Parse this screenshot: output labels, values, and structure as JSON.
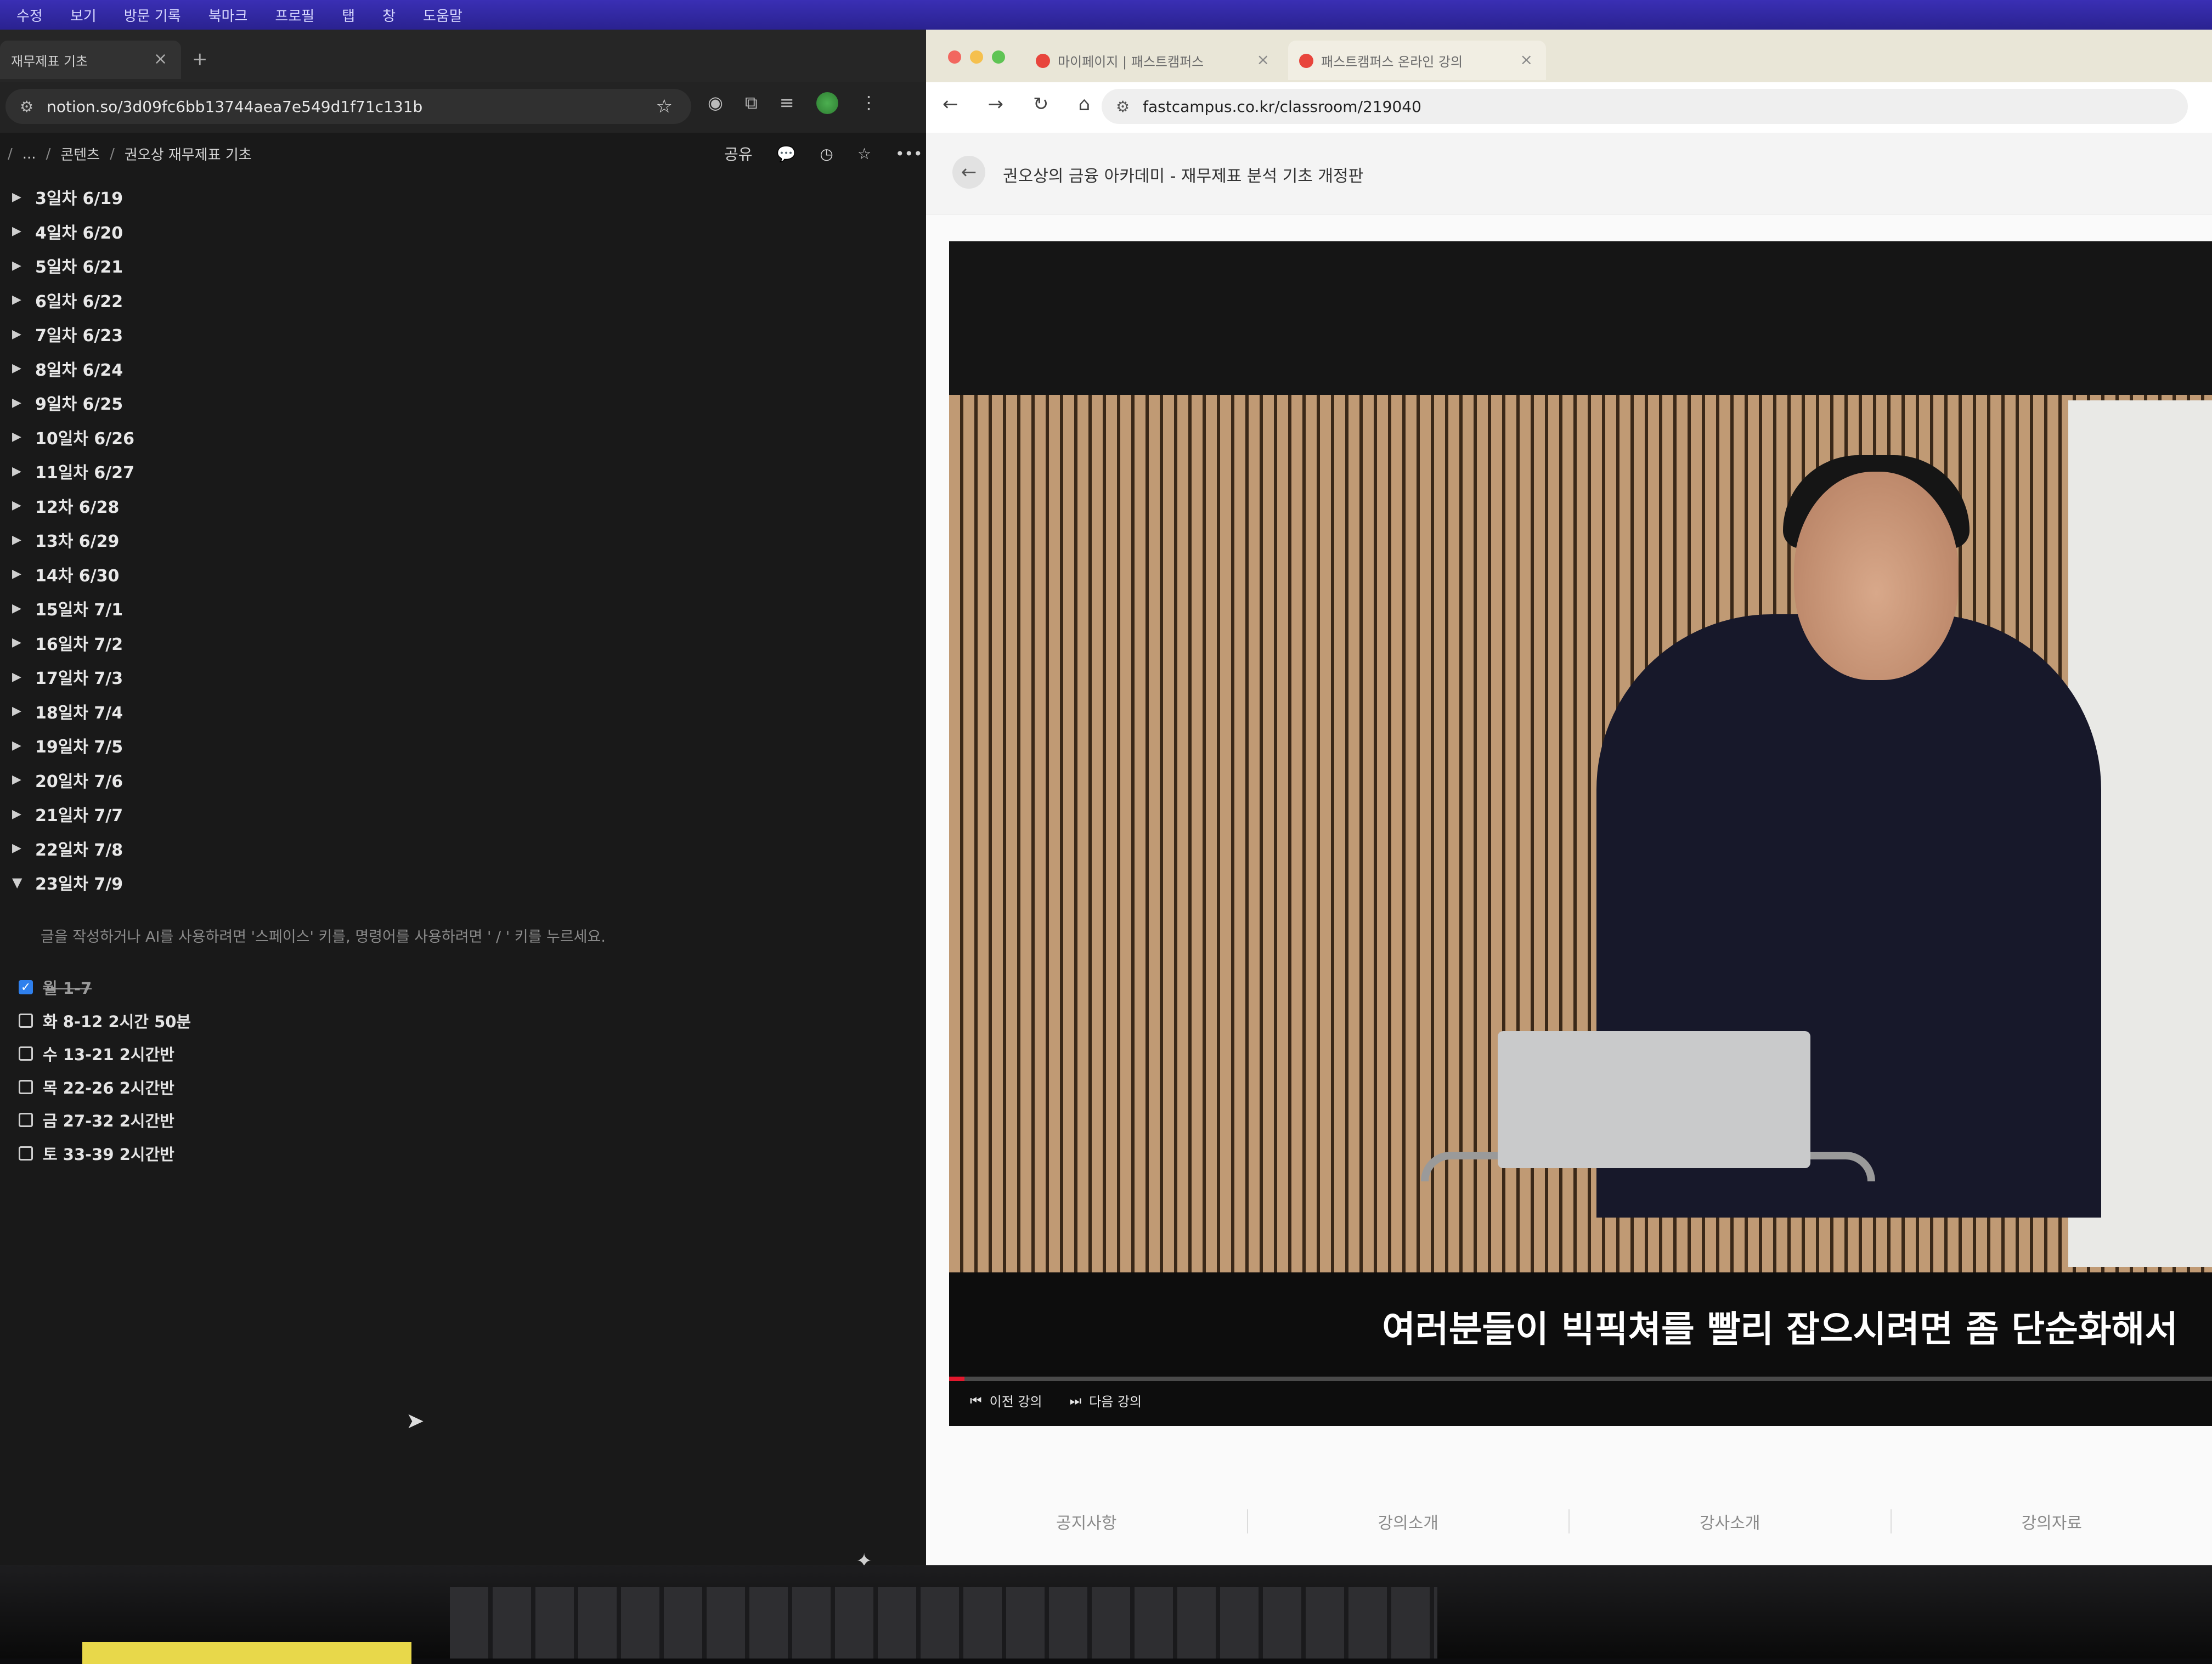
{
  "menubar": {
    "items": [
      "수정",
      "보기",
      "방문 기록",
      "북마크",
      "프로필",
      "탭",
      "창",
      "도움말"
    ]
  },
  "left_browser": {
    "tab_title": "재무제표 기초",
    "url": "notion.so/3d09fc6bb13744aea7e549d1f71c131b",
    "breadcrumb": [
      "...",
      "콘텐츠",
      "권오상 재무제표 기초"
    ],
    "share_label": "공유",
    "toggles": [
      {
        "label": "3일차 6/19",
        "open": false
      },
      {
        "label": "4일차 6/20",
        "open": false
      },
      {
        "label": "5일차 6/21",
        "open": false
      },
      {
        "label": "6일차 6/22",
        "open": false
      },
      {
        "label": "7일차 6/23",
        "open": false
      },
      {
        "label": "8일차 6/24",
        "open": false
      },
      {
        "label": "9일차 6/25",
        "open": false
      },
      {
        "label": "10일차 6/26",
        "open": false
      },
      {
        "label": "11일차 6/27",
        "open": false
      },
      {
        "label": "12차 6/28",
        "open": false
      },
      {
        "label": "13차 6/29",
        "open": false
      },
      {
        "label": "14차 6/30",
        "open": false
      },
      {
        "label": "15일차 7/1",
        "open": false
      },
      {
        "label": "16일차 7/2",
        "open": false
      },
      {
        "label": "17일차 7/3",
        "open": false
      },
      {
        "label": "18일차 7/4",
        "open": false
      },
      {
        "label": "19일차 7/5",
        "open": false
      },
      {
        "label": "20일차 7/6",
        "open": false
      },
      {
        "label": "21일차 7/7",
        "open": false
      },
      {
        "label": "22일차 7/8",
        "open": false
      },
      {
        "label": "23일차 7/9",
        "open": true
      }
    ],
    "placeholder": "글을 작성하거나 AI를 사용하려면 '스페이스' 키를, 명령어를 사용하려면 ' / ' 키를 누르세요.",
    "todos": [
      {
        "label": "월 1-7",
        "checked": true
      },
      {
        "label": "화 8-12 2시간 50분",
        "checked": false
      },
      {
        "label": "수 13-21 2시간반",
        "checked": false
      },
      {
        "label": "목 22-26 2시간반",
        "checked": false
      },
      {
        "label": "금 27-32 2시간반",
        "checked": false
      },
      {
        "label": "토 33-39 2시간반",
        "checked": false
      }
    ]
  },
  "right_browser": {
    "tabs": [
      "마이페이지 | 패스트캠퍼스",
      "패스트캠퍼스 온라인 강의"
    ],
    "url": "fastcampus.co.kr/classroom/219040",
    "course_title": "권오상의 금융 아카데미 - 재무제표 분석 기초 개정판",
    "subtitle": "여러분들이 빅픽쳐를 빨리 잡으시려면 좀 단순화해서",
    "progress": 0.012,
    "prev_label": "이전 강의",
    "next_label": "다음 강의",
    "course_tabs": [
      "공지사항",
      "강의소개",
      "강사소개",
      "강의자료"
    ]
  },
  "colors": {
    "notion_bg": "#191919",
    "checkbox_blue": "#2f80ed",
    "progress_red": "#e3182d"
  }
}
